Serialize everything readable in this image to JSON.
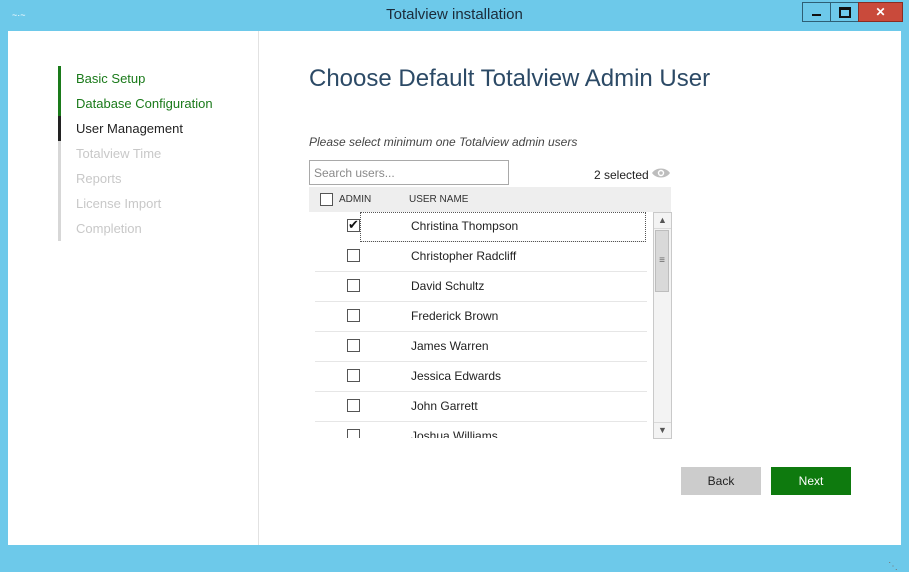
{
  "window": {
    "title": "Totalview installation",
    "icon_text": "~·~"
  },
  "controls": {
    "minimize": "‒",
    "maximize": "□",
    "close": "✕"
  },
  "nav": [
    {
      "label": "Basic Setup",
      "state": "done"
    },
    {
      "label": "Database Configuration",
      "state": "done"
    },
    {
      "label": "User Management",
      "state": "active"
    },
    {
      "label": "Totalview Time",
      "state": "pending"
    },
    {
      "label": "Reports",
      "state": "pending"
    },
    {
      "label": "License Import",
      "state": "pending"
    },
    {
      "label": "Completion",
      "state": "pending"
    }
  ],
  "main": {
    "heading": "Choose Default Totalview Admin User",
    "instruction": "Please select minimum one Totalview admin users",
    "search_placeholder": "Search users...",
    "selected_count": "2 selected",
    "columns": {
      "admin": "ADMIN",
      "name": "USER NAME"
    },
    "users": [
      {
        "name": "Christina Thompson",
        "admin": true
      },
      {
        "name": "Christopher Radcliff",
        "admin": false
      },
      {
        "name": "David Schultz",
        "admin": false
      },
      {
        "name": "Frederick Brown",
        "admin": false
      },
      {
        "name": "James Warren",
        "admin": false
      },
      {
        "name": "Jessica Edwards",
        "admin": false
      },
      {
        "name": "John Garrett",
        "admin": false
      },
      {
        "name": "Joshua Williams",
        "admin": false
      }
    ]
  },
  "buttons": {
    "back": "Back",
    "next": "Next"
  },
  "colors": {
    "titlebar": "#6dc9ea",
    "done": "#1a7a1a",
    "next_button": "#0e7a0e",
    "heading": "#2c4a66"
  }
}
